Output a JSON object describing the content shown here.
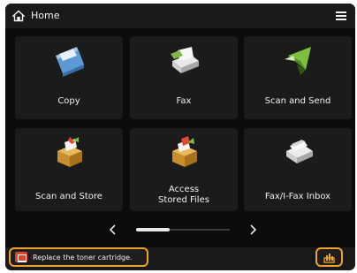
{
  "header": {
    "title": "Home",
    "home_icon": "home-icon",
    "menu_icon": "hamburger-menu-icon"
  },
  "tiles": [
    {
      "label": "Copy",
      "icon": "copy-icon"
    },
    {
      "label": "Fax",
      "icon": "fax-icon"
    },
    {
      "label": "Scan and Send",
      "icon": "scan-and-send-icon"
    },
    {
      "label": "Scan and Store",
      "icon": "scan-and-store-icon"
    },
    {
      "label_line1": "Access",
      "label_line2": "Stored Files",
      "icon": "access-stored-files-icon"
    },
    {
      "label": "Fax/I-Fax Inbox",
      "icon": "fax-inbox-icon"
    }
  ],
  "pagination": {
    "prev_icon": "chevron-left-icon",
    "next_icon": "chevron-right-icon",
    "current_page": 1
  },
  "status": {
    "message": "Replace the toner cartridge.",
    "alert_icon": "toner-alert-icon",
    "status_monitor_icon": "status-monitor-icon",
    "highlight_color": "#f0a22e"
  }
}
